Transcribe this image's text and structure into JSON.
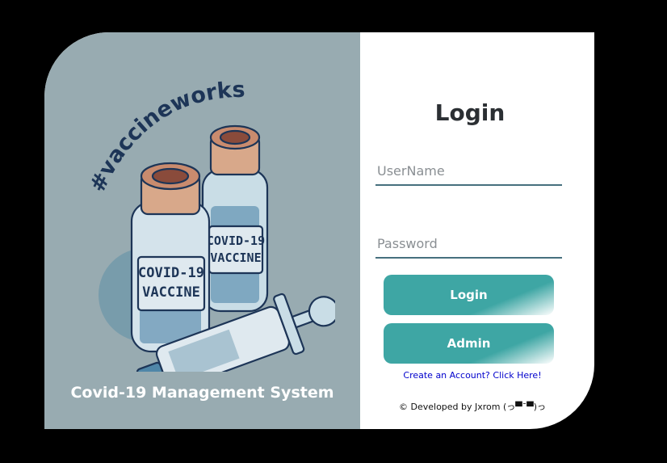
{
  "left_panel": {
    "hashtag": "#vaccineworks",
    "vial_label_line1": "COVID-19",
    "vial_label_line2": "VACCINE",
    "app_title": "Covid-19 Management System"
  },
  "login_form": {
    "title": "Login",
    "username_placeholder": "UserName",
    "password_placeholder": "Password",
    "login_button": "Login",
    "admin_button": "Admin",
    "create_account_link": "Create an Account? Click Here!",
    "developer_credit": "© Developed by Jxrom (っ▀¯▀)っ"
  },
  "colors": {
    "left_panel_bg": "#98abb1",
    "button_teal": "#3ea6a4",
    "field_underline": "#47707e",
    "link_blue": "#0000cc"
  }
}
